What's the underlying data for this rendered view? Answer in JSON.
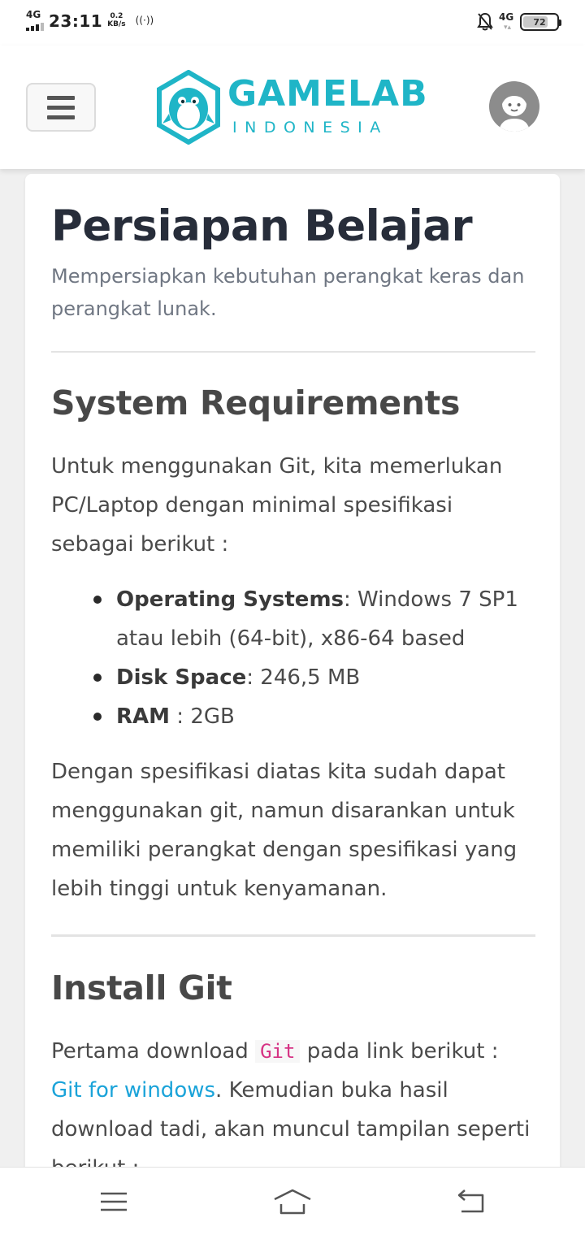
{
  "status_bar": {
    "network_left": "4G",
    "time": "23:11",
    "speed_value": "0.2",
    "speed_unit": "KB/s",
    "network_right": "4G",
    "battery": "72"
  },
  "header": {
    "logo_title": "GAMELAB",
    "logo_subtitle": "INDONESIA",
    "brand_color": "#1fb5c7"
  },
  "content": {
    "title": "Persiapan Belajar",
    "subtitle": "Mempersiapkan kebutuhan perangkat keras dan perangkat lunak.",
    "system_requirements": {
      "heading": "System Requirements",
      "intro": "Untuk menggunakan Git, kita memerlukan PC/Laptop dengan minimal spesifikasi sebagai berikut :",
      "items": [
        {
          "label": "Operating Systems",
          "sep": ": ",
          "value": "Windows 7 SP1 atau lebih (64-bit), x86-64 based"
        },
        {
          "label": "Disk Space",
          "sep": ": ",
          "value": "246,5 MB"
        },
        {
          "label": "RAM",
          "sep": " : ",
          "value": "2GB"
        }
      ],
      "outro": "Dengan spesifikasi diatas kita sudah dapat menggunakan git, namun disarankan untuk memiliki perangkat dengan spesifikasi yang lebih tinggi untuk kenyamanan."
    },
    "install_git": {
      "heading": "Install Git",
      "text_before_code": "Pertama download ",
      "code": "Git",
      "text_after_code": " pada link berikut : ",
      "link": "Git for windows",
      "text_after_link": ". Kemudian buka hasil download tadi, akan muncul tampilan seperti berikut :"
    }
  },
  "colors": {
    "title": "#272d3a",
    "link": "#1aa3d9",
    "code": "#d63384"
  },
  "bottom_nav": {
    "icons": [
      "menu-icon",
      "home-icon",
      "back-icon"
    ]
  }
}
